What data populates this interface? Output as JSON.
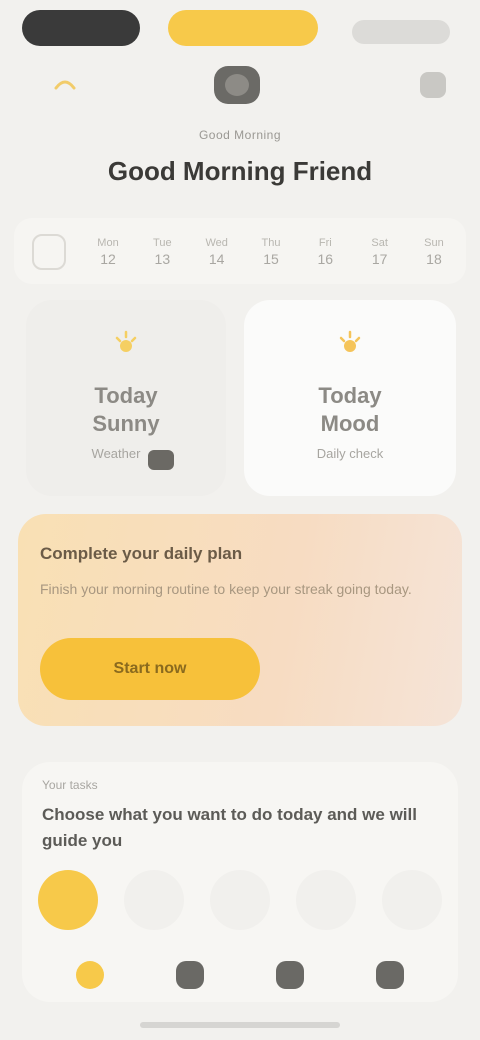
{
  "header": {
    "greeting": "Good Morning",
    "title": "Good Morning Friend"
  },
  "date_strip": {
    "days": [
      {
        "weekday": "Mon",
        "date": "12"
      },
      {
        "weekday": "Tue",
        "date": "13"
      },
      {
        "weekday": "Wed",
        "date": "14"
      },
      {
        "weekday": "Thu",
        "date": "15"
      },
      {
        "weekday": "Fri",
        "date": "16"
      },
      {
        "weekday": "Sat",
        "date": "17"
      },
      {
        "weekday": "Sun",
        "date": "18"
      }
    ]
  },
  "cards": {
    "left": {
      "value": "Today\nSunny",
      "label": "Weather"
    },
    "right": {
      "value": "Today\nMood",
      "label": "Daily check"
    }
  },
  "promo": {
    "title": "Complete your daily plan",
    "text": "Finish your morning routine to keep your streak going today.",
    "button_label": "Start now"
  },
  "tasks": {
    "subtitle": "Your tasks",
    "title": "Choose what you want to do today and we will guide you"
  },
  "colors": {
    "accent": "#f7c94a",
    "background": "#f2f1ee",
    "dark": "#3a3a3a"
  }
}
